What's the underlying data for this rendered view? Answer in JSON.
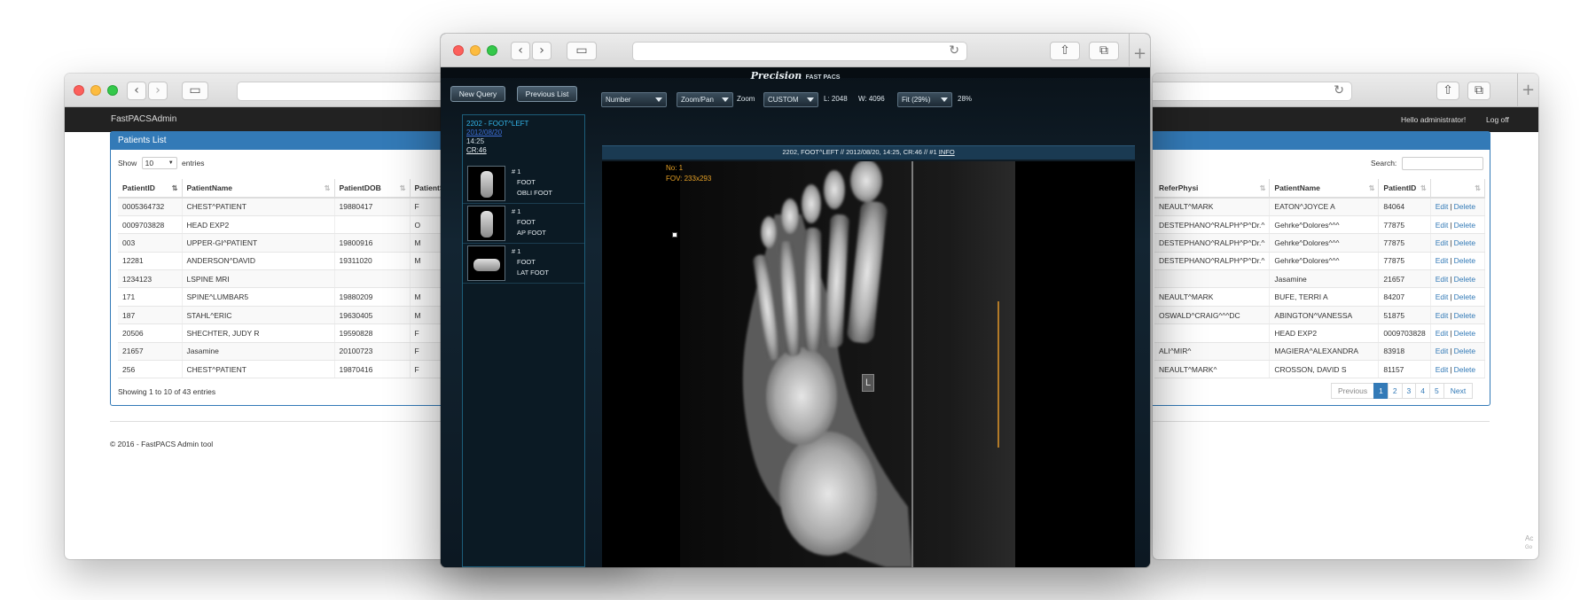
{
  "admin_window": {
    "brand": "FastPACSAdmin",
    "greeting": "Hello administrator!",
    "logoff": "Log off",
    "footer": "© 2016 - FastPACS Admin tool"
  },
  "patients_panel": {
    "title": "Patients List",
    "show_label": "Show",
    "entries_value": "10",
    "entries_label": "entries",
    "columns": [
      "PatientID",
      "PatientName",
      "PatientDOB",
      "PatientSe"
    ],
    "rows": [
      [
        "0005364732",
        "CHEST^PATIENT",
        "19880417",
        "F"
      ],
      [
        "0009703828",
        "HEAD EXP2",
        "",
        "O"
      ],
      [
        "003",
        "UPPER-GI^PATIENT",
        "19800916",
        "M"
      ],
      [
        "12281",
        "ANDERSON^DAVID",
        "19311020",
        "M"
      ],
      [
        "1234123",
        "LSPINE MRI",
        "",
        ""
      ],
      [
        "171",
        "SPINE^LUMBAR5",
        "19880209",
        "M"
      ],
      [
        "187",
        "STAHL^ERIC",
        "19630405",
        "M"
      ],
      [
        "20506",
        "SHECHTER, JUDY R",
        "19590828",
        "F"
      ],
      [
        "21657",
        "Jasamine",
        "20100723",
        "F"
      ],
      [
        "256",
        "CHEST^PATIENT",
        "19870416",
        "F"
      ]
    ],
    "showing_text": "Showing 1 to 10 of 43 entries"
  },
  "studies_panel": {
    "search_label": "Search:",
    "columns": [
      "ReferPhysi",
      "PatientName",
      "PatientID",
      ""
    ],
    "rows": [
      [
        "NEAULT^MARK",
        "EATON^JOYCE A",
        "84064"
      ],
      [
        "DESTEPHANO^RALPH^P^Dr.^",
        "Gehrke^Dolores^^^",
        "77875"
      ],
      [
        "DESTEPHANO^RALPH^P^Dr.^",
        "Gehrke^Dolores^^^",
        "77875"
      ],
      [
        "DESTEPHANO^RALPH^P^Dr.^",
        "Gehrke^Dolores^^^",
        "77875"
      ],
      [
        "",
        "Jasamine",
        "21657"
      ],
      [
        "NEAULT^MARK",
        "BUFE, TERRI A",
        "84207"
      ],
      [
        "OSWALD^CRAIG^^^DC",
        "ABINGTON^VANESSA",
        "51875"
      ],
      [
        "",
        "HEAD EXP2",
        "0009703828"
      ],
      [
        "ALI^MIR^",
        "MAGIERA^ALEXANDRA",
        "83918"
      ],
      [
        "NEAULT^MARK^",
        "CROSSON, DAVID S",
        "81157"
      ]
    ],
    "edit_label": "Edit",
    "separator": "|",
    "delete_label": "Delete",
    "pagination": [
      "Previous",
      "1",
      "2",
      "3",
      "4",
      "5",
      "Next"
    ],
    "corner_text_1": "Ac",
    "corner_text_2": "Go"
  },
  "viewer": {
    "logo_main": "Precision",
    "logo_sub": "FAST PACS",
    "new_query": "New Query",
    "previous_list": "Previous List",
    "sort_select": "Number",
    "tool_select": "Zoom/Pan",
    "tool_label": "Zoom",
    "window_select": "CUSTOM",
    "level_text": "L: 2048",
    "width_text": "W: 4096",
    "fit_select": "Fit (29%)",
    "zoom_percent": "28%",
    "study_title": "2202 - FOOT^LEFT",
    "study_date": "2012/08/20",
    "study_time": "14:25",
    "study_modality": "CR:46",
    "series": [
      {
        "number": "# 1",
        "line1": "FOOT",
        "line2": "OBLI FOOT"
      },
      {
        "number": "# 1",
        "line1": "FOOT",
        "line2": "AP FOOT"
      },
      {
        "number": "# 1",
        "line1": "FOOT",
        "line2": "LAT FOOT"
      }
    ],
    "image_header": "2202, FOOT^LEFT // 2012/08/20, 14:25, CR:46 // #1",
    "info_link": "INFO",
    "overlay_no": "No: 1",
    "overlay_fov": "FOV: 233x293",
    "marker": "L"
  }
}
